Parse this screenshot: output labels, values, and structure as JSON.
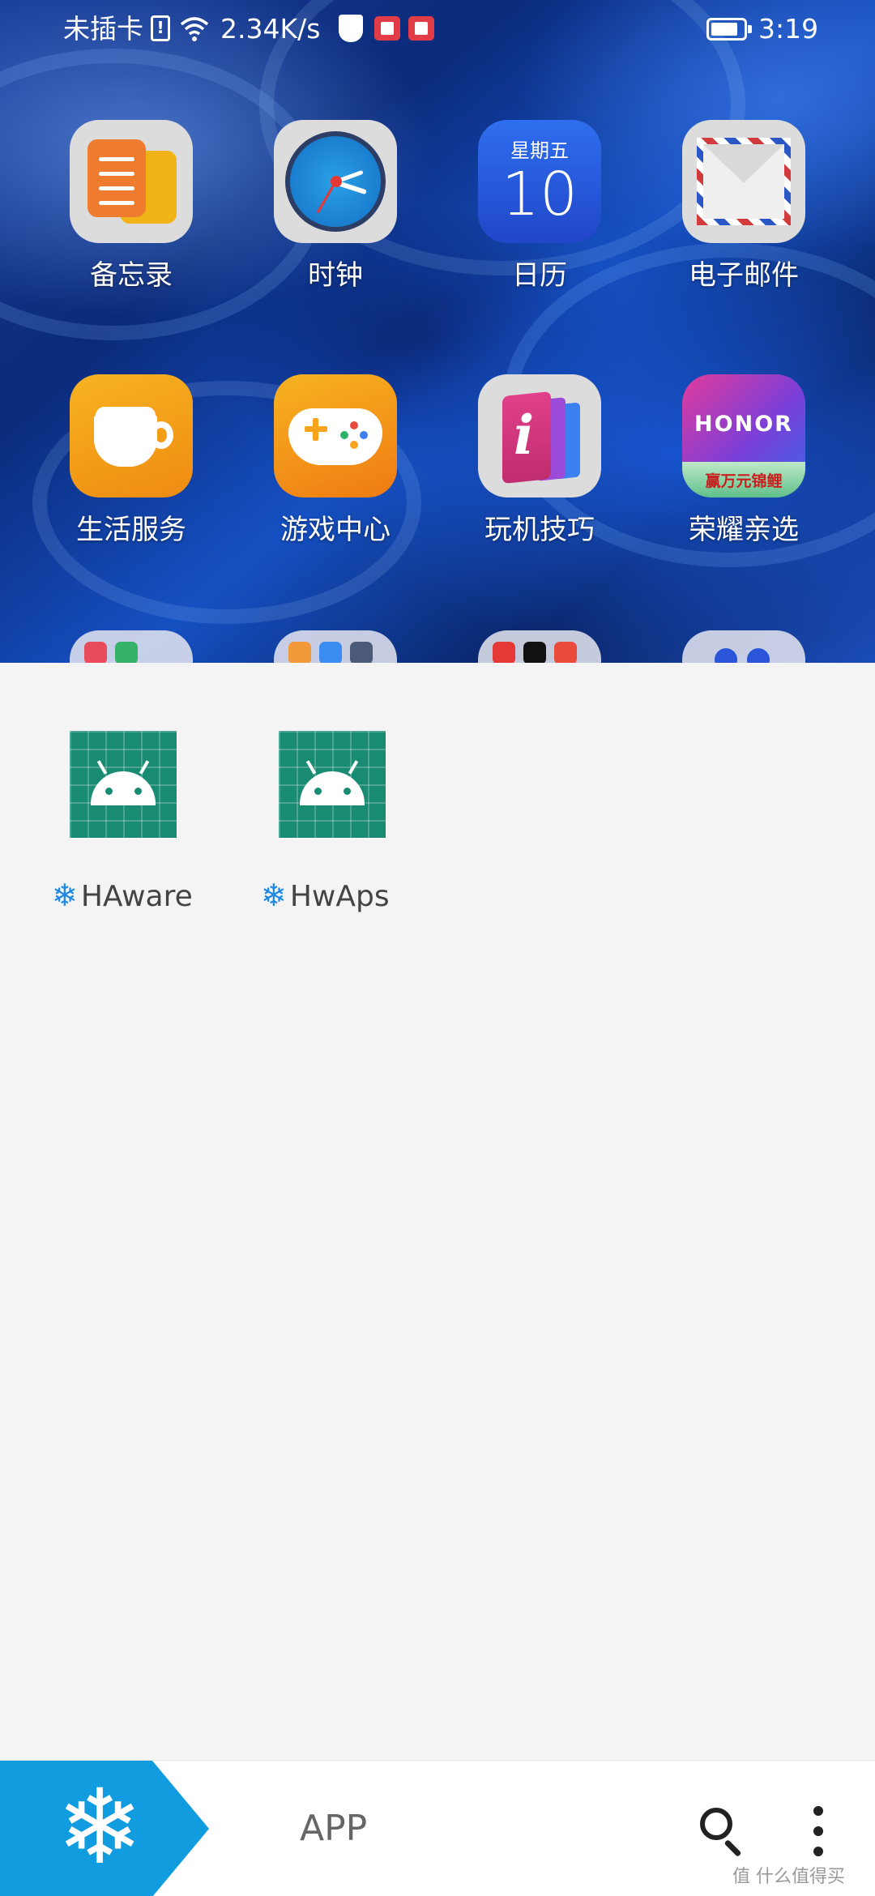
{
  "status_bar": {
    "carrier": "未插卡",
    "sim_icon": "sim-alert-icon",
    "network_speed": "2.34K/s",
    "time": "3:19",
    "battery_icon": "battery-icon"
  },
  "home_apps": [
    {
      "label": "备忘录",
      "icon": "memo-icon"
    },
    {
      "label": "时钟",
      "icon": "clock-icon"
    },
    {
      "label": "日历",
      "icon": "calendar-icon",
      "weekday": "星期五",
      "day": "10"
    },
    {
      "label": "电子邮件",
      "icon": "email-icon"
    },
    {
      "label": "生活服务",
      "icon": "coffee-cup-icon"
    },
    {
      "label": "游戏中心",
      "icon": "gamepad-icon"
    },
    {
      "label": "玩机技巧",
      "icon": "tips-icon"
    },
    {
      "label": "荣耀亲选",
      "icon": "honor-store-icon",
      "brand": "HONOR",
      "promo": "赢万元锦鲤"
    }
  ],
  "frozen_apps": [
    {
      "label": "HAware",
      "icon": "android-icon",
      "frozen_marker": "❄"
    },
    {
      "label": "HwAps",
      "icon": "android-icon",
      "frozen_marker": "❄"
    }
  ],
  "bottom_bar": {
    "logo_icon": "snowflake-icon",
    "logo_glyph": "❄",
    "title": "APP",
    "search_icon": "search-icon",
    "more_icon": "more-vertical-icon"
  },
  "watermark": "值 什么值得买",
  "colors": {
    "accent": "#129CE0",
    "android_tile": "#1A8B73",
    "panel_background": "#F4F4F4"
  }
}
